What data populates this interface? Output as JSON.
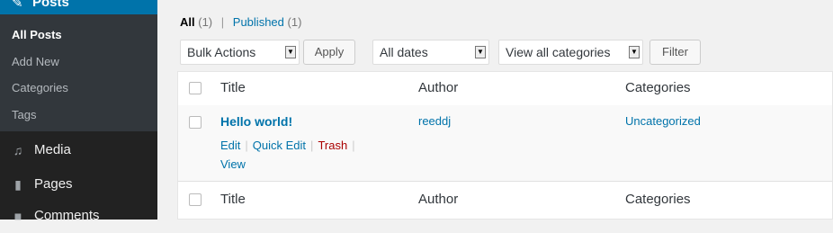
{
  "sidebar": {
    "posts_label": "Posts",
    "submenu": [
      {
        "label": "All Posts",
        "current": true
      },
      {
        "label": "Add New",
        "current": false
      },
      {
        "label": "Categories",
        "current": false
      },
      {
        "label": "Tags",
        "current": false
      }
    ],
    "menu": [
      {
        "label": "Media",
        "icon": "media-icon"
      },
      {
        "label": "Pages",
        "icon": "pages-icon"
      },
      {
        "label": "Comments",
        "icon": "comments-icon"
      }
    ]
  },
  "views": {
    "all_label": "All",
    "all_count": "(1)",
    "published_label": "Published",
    "published_count": "(1)"
  },
  "filters": {
    "bulk_actions": "Bulk Actions",
    "apply": "Apply",
    "dates": "All dates",
    "categories": "View all categories",
    "filter": "Filter"
  },
  "table": {
    "columns": {
      "title": "Title",
      "author": "Author",
      "categories": "Categories"
    },
    "rows": [
      {
        "title": "Hello world!",
        "author": "reeddj",
        "category": "Uncategorized",
        "actions": {
          "edit": "Edit",
          "quick_edit": "Quick Edit",
          "trash": "Trash",
          "view": "View"
        }
      }
    ]
  },
  "colors": {
    "accent": "#0073aa",
    "sidebar": "#222222",
    "trash": "#aa0000"
  }
}
